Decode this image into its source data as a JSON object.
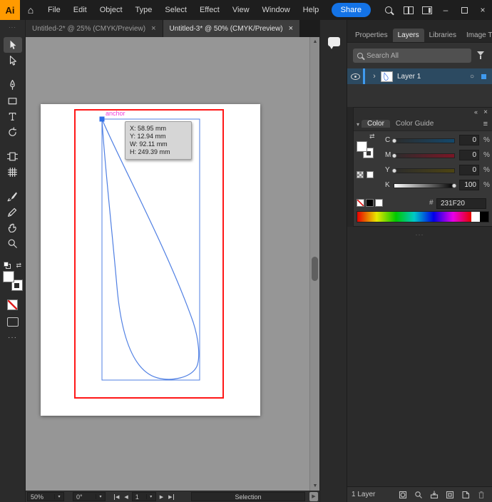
{
  "app": {
    "logo_text": "Ai",
    "menus": [
      "File",
      "Edit",
      "Object",
      "Type",
      "Select",
      "Effect",
      "View",
      "Window",
      "Help"
    ],
    "share_label": "Share"
  },
  "icons": {
    "home": "⌂",
    "close": "×",
    "minimize": "–",
    "chevron_right": "›",
    "caret_down": "▾",
    "scroll_up": "▲",
    "scroll_down": "▼",
    "nav_prev": "◀",
    "nav_next": "▶",
    "collapse_panel": "«",
    "panel_menu": "≡",
    "grip_dots": "···",
    "ellipsis": "···",
    "target_circle": "○",
    "swap_arrows": "⇄"
  },
  "tabs": [
    {
      "label": "Untitled-2* @ 25% (CMYK/Preview)",
      "active": false
    },
    {
      "label": "Untitled-3* @ 50% (CMYK/Preview)",
      "active": true
    }
  ],
  "toolbar": {
    "tools": [
      {
        "name": "selection-tool",
        "selected": true
      },
      {
        "name": "direct-selection-tool"
      },
      {
        "name": "pen-tool",
        "gap_before": true
      },
      {
        "name": "rectangle-tool"
      },
      {
        "name": "type-tool"
      },
      {
        "name": "rotate-tool"
      },
      {
        "name": "artboard-tool",
        "gap_before": true
      },
      {
        "name": "mesh-tool"
      },
      {
        "name": "paintbrush-tool",
        "gap_before": true
      },
      {
        "name": "pencil-tool"
      },
      {
        "name": "hand-tool"
      },
      {
        "name": "zoom-tool"
      }
    ]
  },
  "canvas": {
    "anchor_label": "anchor",
    "tooltip": {
      "x": "X: 58.95 mm",
      "y": "Y: 12.94 mm",
      "w": "W: 92.11 mm",
      "h": "H: 249.39 mm"
    }
  },
  "dock": {
    "tabs": [
      {
        "label": "Properties",
        "active": false
      },
      {
        "label": "Layers",
        "active": true
      },
      {
        "label": "Libraries",
        "active": false
      },
      {
        "label": "Image Tra",
        "active": false
      }
    ],
    "layers": {
      "search_placeholder": "Search All",
      "rows": [
        {
          "name": "Layer 1"
        }
      ],
      "footer_count": "1 Layer"
    },
    "color": {
      "tabs": [
        {
          "label": "Color",
          "active": true
        },
        {
          "label": "Color Guide",
          "active": false
        }
      ],
      "unit": "%",
      "sliders": [
        {
          "label": "C",
          "value": 0
        },
        {
          "label": "M",
          "value": 0
        },
        {
          "label": "Y",
          "value": 0
        },
        {
          "label": "K",
          "value": 100
        }
      ],
      "hex_prefix": "#",
      "hex_value": "231F20"
    }
  },
  "statusbar": {
    "zoom": "50%",
    "rotation": "0°",
    "artboard_number": "1",
    "tool_name": "Selection"
  },
  "colors": {
    "share_blue": "#1473e6",
    "selection_red": "#ff1717",
    "path_blue": "#4f7fe3",
    "anchor_blue": "#2f6fe8",
    "anchor_magenta": "#f03ddb",
    "layer_highlight": "#2c4a61",
    "logo_orange": "#ff9a00",
    "hex_current": "231F20"
  }
}
